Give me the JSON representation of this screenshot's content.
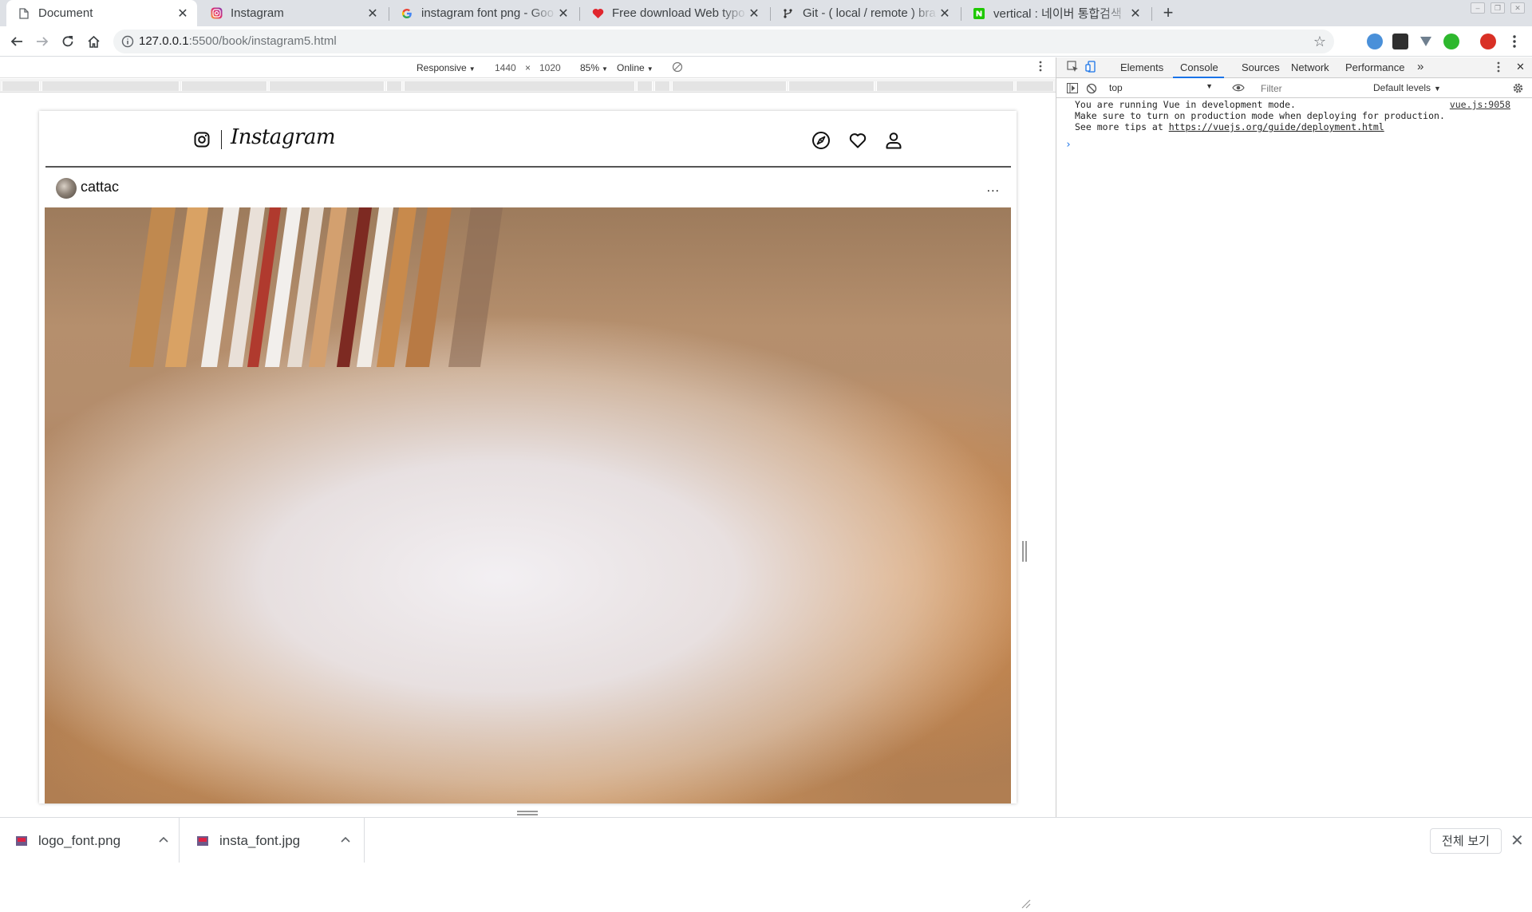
{
  "browser": {
    "tabs": [
      {
        "title": "Document",
        "icon": "document-icon",
        "active": true
      },
      {
        "title": "Instagram",
        "icon": "instagram-favicon",
        "active": false
      },
      {
        "title": "instagram font png - Goo",
        "icon": "google-favicon",
        "active": false
      },
      {
        "title": "Free download Web typo",
        "icon": "heart-favicon",
        "active": false
      },
      {
        "title": "Git - ( local / remote ) bra",
        "icon": "git-favicon",
        "active": false
      },
      {
        "title": "vertical : 네이버 통합검색",
        "icon": "naver-favicon",
        "active": false
      }
    ],
    "new_tab": "+",
    "close_glyph": "✕",
    "url_host": "127.0.0.1",
    "url_rest": ":5500/book/instagram5.html"
  },
  "device_toolbar": {
    "mode": "Responsive",
    "width": "1440",
    "times": "×",
    "height": "1020",
    "zoom": "85%",
    "network": "Online"
  },
  "page": {
    "logo_text": "Instagram",
    "post": {
      "username": "cattac",
      "more": "..."
    }
  },
  "devtools": {
    "tabs": [
      "Elements",
      "Console",
      "Sources",
      "Network",
      "Performance"
    ],
    "active_tab": "Console",
    "more_tabs": "»",
    "context": "top",
    "filter_placeholder": "Filter",
    "levels": "Default levels",
    "console_lines": [
      "You are running Vue in development mode.",
      "Make sure to turn on production mode when deploying for production.",
      "See more tips at "
    ],
    "console_link": "https://vuejs.org/guide/deployment.html",
    "console_source": "vue.js:9058",
    "prompt": "›"
  },
  "downloads": {
    "items": [
      {
        "name": "logo_font.png"
      },
      {
        "name": "insta_font.jpg"
      }
    ],
    "show_all": "전체 보기",
    "close": "✕"
  },
  "colors": {
    "accent": "#1a73e8",
    "tab_strip": "#dee1e6"
  }
}
